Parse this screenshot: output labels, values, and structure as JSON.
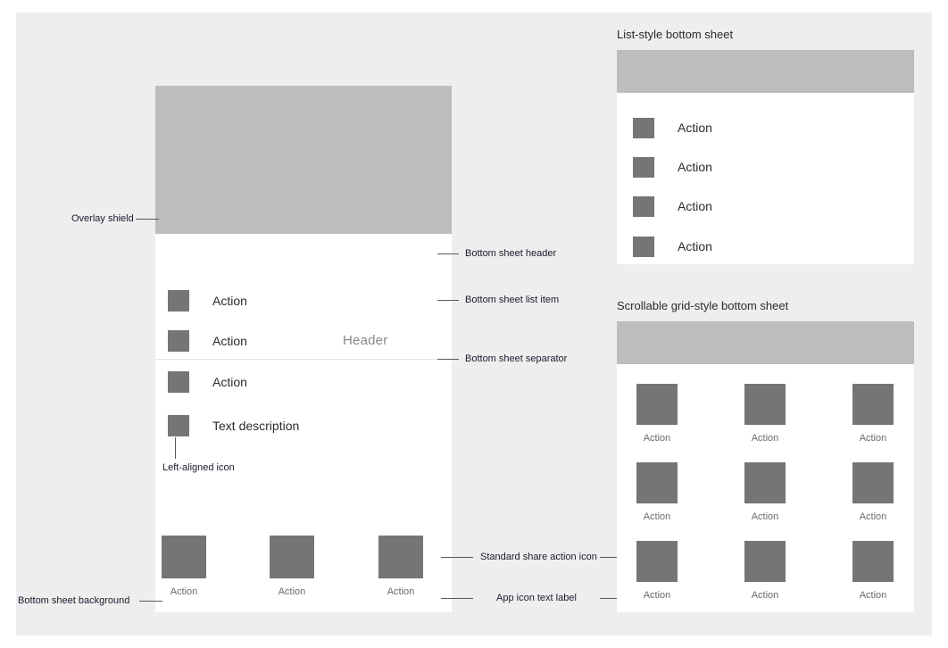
{
  "canvas": {
    "background": "#eeeeee",
    "page_background": "#ffffff"
  },
  "colors": {
    "overlay_shield": "#bdbdbd",
    "icon_swatch": "#757575",
    "sheet_background": "#ffffff",
    "separator": "#e2e2e2",
    "header_text": "#8a8a8a",
    "label_text": "#6b6b6b",
    "annotation_text": "#1a1a2e",
    "leader_line": "#595959"
  },
  "main_sheet": {
    "header": "Header",
    "list_items": [
      {
        "label": "Action"
      },
      {
        "label": "Action"
      },
      {
        "label": "Action"
      },
      {
        "label": "Text description"
      }
    ],
    "share_items": [
      {
        "label": "Action"
      },
      {
        "label": "Action"
      },
      {
        "label": "Action"
      }
    ]
  },
  "list_sheet": {
    "title": "List-style bottom sheet",
    "items": [
      {
        "label": "Action"
      },
      {
        "label": "Action"
      },
      {
        "label": "Action"
      },
      {
        "label": "Action"
      }
    ]
  },
  "grid_sheet": {
    "title": "Scrollable grid-style bottom sheet",
    "cells": [
      {
        "label": "Action"
      },
      {
        "label": "Action"
      },
      {
        "label": "Action"
      },
      {
        "label": "Action"
      },
      {
        "label": "Action"
      },
      {
        "label": "Action"
      },
      {
        "label": "Action"
      },
      {
        "label": "Action"
      },
      {
        "label": "Action"
      }
    ]
  },
  "annotations": {
    "overlay_shield": "Overlay shield",
    "bottom_sheet_header": "Bottom sheet header",
    "bottom_sheet_list_item": "Bottom sheet list item",
    "bottom_sheet_separator": "Bottom sheet separator",
    "left_aligned_icon": "Left-aligned icon",
    "bottom_sheet_background": "Bottom sheet background",
    "standard_share_action_icon": "Standard share action icon",
    "app_icon_text_label": "App icon text label"
  }
}
